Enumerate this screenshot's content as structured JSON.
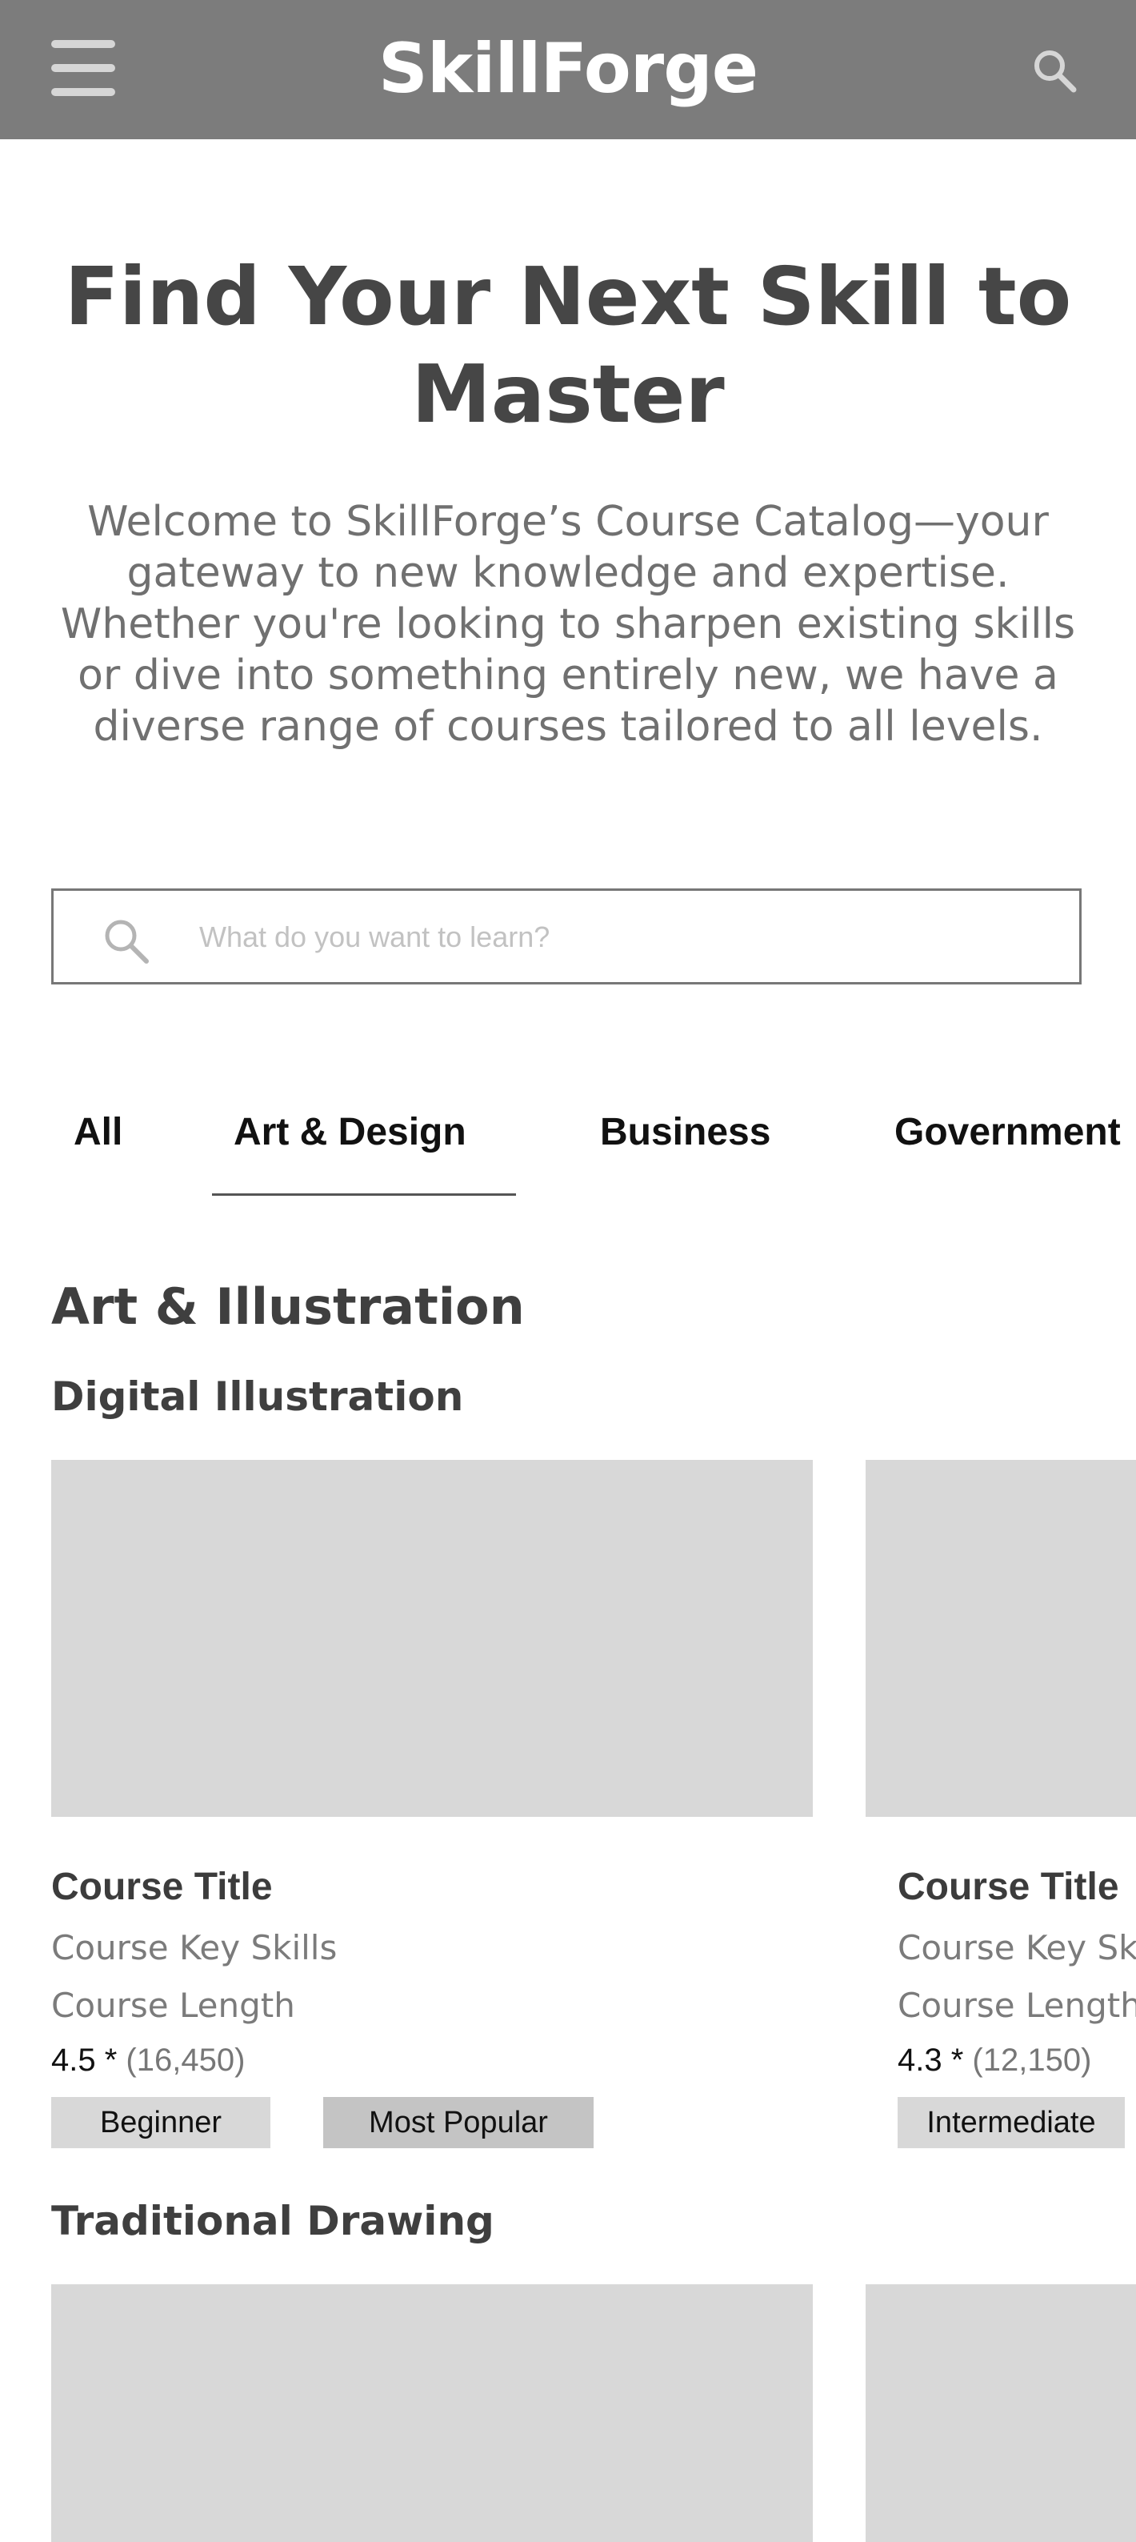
{
  "header": {
    "logo": "SkillForge",
    "menu_icon": "hamburger-menu-icon",
    "search_icon": "search-icon",
    "background": "#7c7c7c"
  },
  "hero": {
    "title": "Find Your Next Skill to Master",
    "intro": "Welcome to SkillForge’s Course Catalog—your gateway to new knowledge and expertise. Whether you're looking to sharpen existing skills or dive into something entirely new, we have a diverse range of courses tailored to all levels."
  },
  "search": {
    "placeholder": "What do you want to learn?",
    "value": ""
  },
  "tabs": [
    {
      "label": "All"
    },
    {
      "label": "Art & Design",
      "active": true
    },
    {
      "label": "Business"
    },
    {
      "label": "Government"
    }
  ],
  "section": {
    "heading": "Art & Illustration",
    "subsections": [
      {
        "heading": "Digital Illustration",
        "cards": [
          {
            "title": "Course Title",
            "skills": "Course Key Skills",
            "length": "Course Length",
            "rating": "4.5 *",
            "reviews": "(16,450)",
            "tags": [
              "Beginner",
              "Most Popular"
            ]
          },
          {
            "title": "Course Title",
            "skills": "Course Key Skills",
            "length": "Course Length",
            "rating": "4.3 *",
            "reviews": "(12,150)",
            "tags": [
              "Intermediate"
            ]
          }
        ]
      },
      {
        "heading": "Traditional Drawing",
        "cards": [
          {},
          {}
        ]
      }
    ]
  },
  "colors": {
    "header": "#7c7c7c",
    "placeholder_image": "#d8d8d8",
    "tag_light": "#d8d8d8",
    "tag_dark": "#c4c4c4"
  }
}
